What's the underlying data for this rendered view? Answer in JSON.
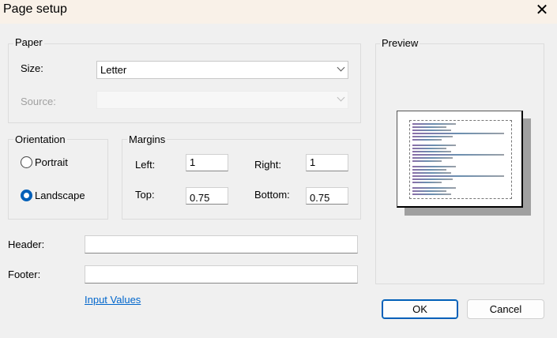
{
  "window": {
    "title": "Page setup",
    "close_icon": "close-icon"
  },
  "paper": {
    "label": "Paper",
    "size_label": "Size:",
    "size_value": "Letter",
    "source_label": "Source:",
    "source_value": ""
  },
  "orientation": {
    "label": "Orientation",
    "portrait": "Portrait",
    "landscape": "Landscape",
    "selected": "Landscape"
  },
  "margins": {
    "label": "Margins",
    "left_label": "Left:",
    "left_value": "1",
    "right_label": "Right:",
    "right_value": "1",
    "top_label": "Top:",
    "top_value": "0.75",
    "bottom_label": "Bottom:",
    "bottom_value": "0.75"
  },
  "header": {
    "label": "Header:",
    "value": ""
  },
  "footer": {
    "label": "Footer:",
    "value": ""
  },
  "input_values_link": "Input Values",
  "preview": {
    "label": "Preview"
  },
  "buttons": {
    "ok": "OK",
    "cancel": "Cancel"
  },
  "colors": {
    "accent": "#005fb8",
    "titlebar": "#f9f1e8",
    "background": "#f0f0f0"
  }
}
